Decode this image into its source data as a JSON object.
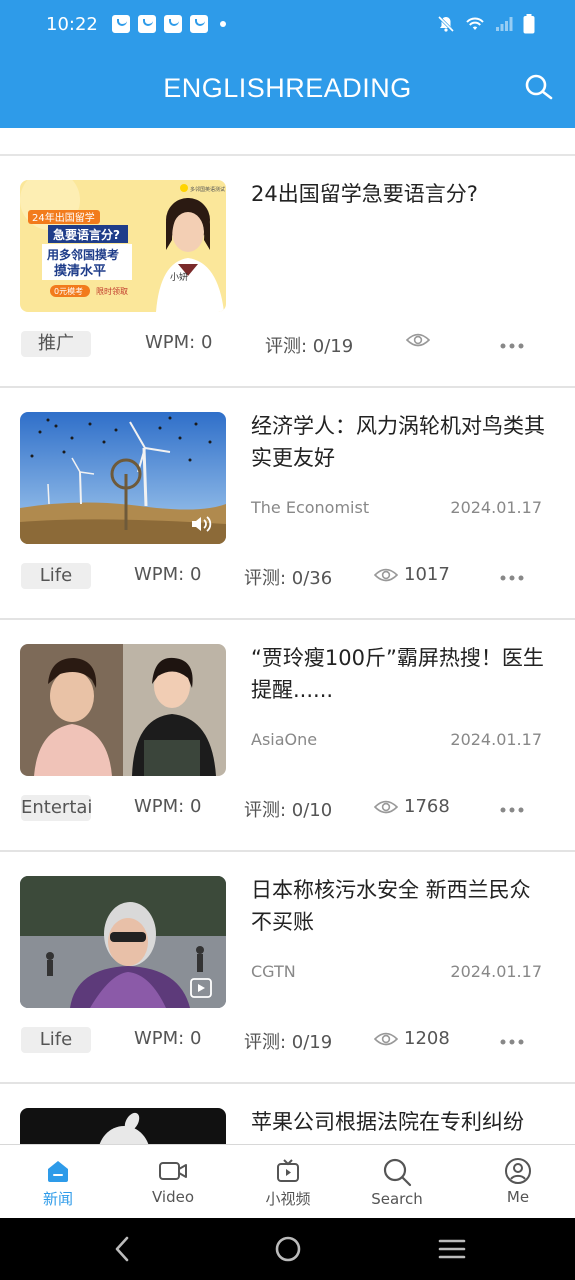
{
  "status_bar": {
    "time": "10:22"
  },
  "app_bar": {
    "title": "ENGLISHREADING"
  },
  "articles": [
    {
      "title": "24出国留学急要语言分?",
      "source": "",
      "date": "",
      "tag": "推广",
      "wpm": "WPM: 0",
      "score": "评测: 0/19",
      "views": "",
      "thumb_text": {
        "banner": "24年出国留学",
        "line1": "急要语言分?",
        "line2": "用多邻国摸考",
        "line3": "摸清水平",
        "badge": "0元模考",
        "badge2": "限时领取",
        "name": "小妍",
        "brand": "多邻国英语测试"
      }
    },
    {
      "title": "经济学人：风力涡轮机对鸟类其实更友好",
      "source": "The Economist",
      "date": "2024.01.17",
      "tag": "Life",
      "wpm": "WPM: 0",
      "score": "评测: 0/36",
      "views": "1017"
    },
    {
      "title": "“贾玲瘦100斤”霸屏热搜！医生提醒......",
      "source": "AsiaOne",
      "date": "2024.01.17",
      "tag": "Entertai",
      "wpm": "WPM: 0",
      "score": "评测: 0/10",
      "views": "1768"
    },
    {
      "title": "日本称核污水安全 新西兰民众不买账",
      "source": "CGTN",
      "date": "2024.01.17",
      "tag": "Life",
      "wpm": "WPM: 0",
      "score": "评测: 0/19",
      "views": "1208"
    },
    {
      "title": "苹果公司根据法院在专利纠纷"
    }
  ],
  "tabs": [
    {
      "label": "新闻",
      "icon": "home-icon",
      "active": true
    },
    {
      "label": "Video",
      "icon": "video-camera-icon",
      "active": false
    },
    {
      "label": "小视频",
      "icon": "tv-play-icon",
      "active": false
    },
    {
      "label": "Search",
      "icon": "search-icon",
      "active": false
    },
    {
      "label": "Me",
      "icon": "user-icon",
      "active": false
    }
  ],
  "colors": {
    "primary": "#2e9be9",
    "text": "#222222",
    "muted": "#888888"
  }
}
